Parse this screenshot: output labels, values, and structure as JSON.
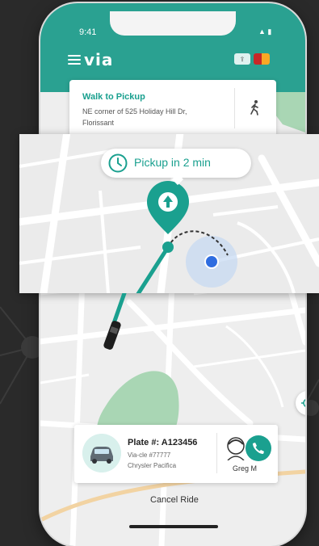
{
  "status": {
    "time": "9:41",
    "icons": "▲ ▮"
  },
  "app": {
    "logo": "via"
  },
  "colors": {
    "accent": "#1aa08f",
    "map_bg": "#eeeeee",
    "park": "#a9d6b4"
  },
  "walk_card": {
    "title": "Walk to Pickup",
    "address": "NE corner of 525 Holiday Hill Dr, Florissant",
    "icon": "walking-person-icon"
  },
  "pickup": {
    "text": "Pickup in 2 min",
    "icon": "clock-icon"
  },
  "ride": {
    "plate": "Plate #: A123456",
    "vehicle_id": "Via-cle #77777",
    "vehicle_model": "Chrysler Pacifica",
    "driver_name": "Greg M",
    "call_icon": "phone-icon"
  },
  "actions": {
    "cancel_label": "Cancel Ride"
  }
}
